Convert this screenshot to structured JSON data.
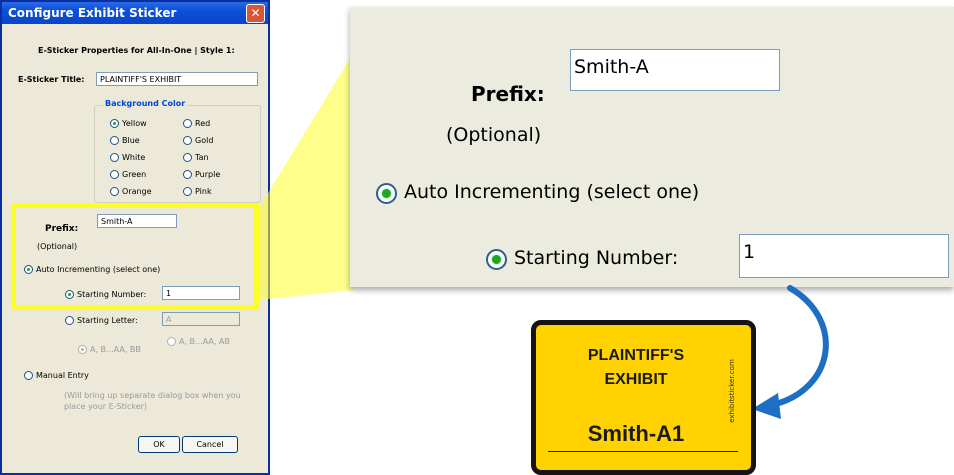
{
  "dialog": {
    "title": "Configure Exhibit Sticker",
    "close_glyph": "✕",
    "header": "E-Sticker Properties for All-In-One | Style 1:",
    "title_label": "E-Sticker Title:",
    "title_value": "PLAINTIFF'S EXHIBIT",
    "bg_group_label": "Background Color",
    "colors": [
      "Yellow",
      "Red",
      "Blue",
      "Gold",
      "White",
      "Tan",
      "Green",
      "Purple",
      "Orange",
      "Pink"
    ],
    "selected_color": "Yellow",
    "prefix_label": "Prefix:",
    "prefix_optional": "(Optional)",
    "prefix_value": "Smith-A",
    "auto_inc_label": "Auto Incrementing (select one)",
    "starting_number_label": "Starting Number:",
    "starting_number_value": "1",
    "starting_letter_label": "Starting Letter:",
    "starting_letter_value": "A",
    "letter_opt1": "A, B...AA, BB",
    "letter_opt2": "A, B...AA, AB",
    "manual_entry_label": "Manual Entry",
    "manual_note": "(Will bring up separate dialog box when you place your E-Sticker)",
    "ok_label": "OK",
    "cancel_label": "Cancel"
  },
  "zoom": {
    "prefix_label": "Prefix:",
    "prefix_optional": "(Optional)",
    "prefix_value": "Smith-A",
    "auto_inc_label": "Auto Incrementing (select one)",
    "starting_number_label": "Starting Number:",
    "starting_number_value": "1"
  },
  "sticker": {
    "line1": "PLAINTIFF'S",
    "line2": "EXHIBIT",
    "number": "Smith-A1",
    "side_text": "exhibitsticker.com",
    "bg_color": "#ffd200"
  },
  "colors": {
    "highlight": "#fdfd2a",
    "arrow": "#1c6fc4",
    "titlebar": "#0b4fd8"
  }
}
